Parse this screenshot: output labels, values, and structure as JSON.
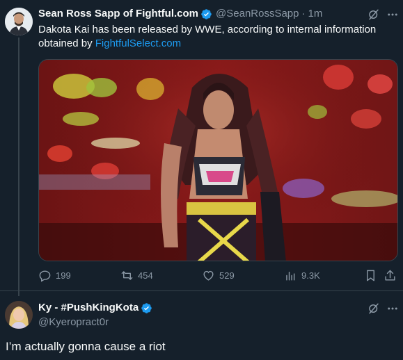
{
  "tweet": {
    "author_name": "Sean Ross Sapp of Fightful.com",
    "author_handle": "@SeanRossSapp",
    "separator": "·",
    "time": "1m",
    "text_before_link": "Dakota Kai has been released by WWE, according to internal information obtained by ",
    "link_text": "FightfulSelect.com",
    "media_icon_name": "wrestler-photo",
    "actions": {
      "replies": "199",
      "reposts": "454",
      "likes": "529",
      "views": "9.3K"
    }
  },
  "reply": {
    "author_name": "Ky - #PushKingKota",
    "author_handle": "@Kyeropract0r",
    "text": "I’m actually gonna cause a riot"
  },
  "colors": {
    "background": "#15202b",
    "text_primary": "#f7f9f9",
    "text_secondary": "#8b98a5",
    "link": "#1d9bf0",
    "divider": "#38444d"
  }
}
